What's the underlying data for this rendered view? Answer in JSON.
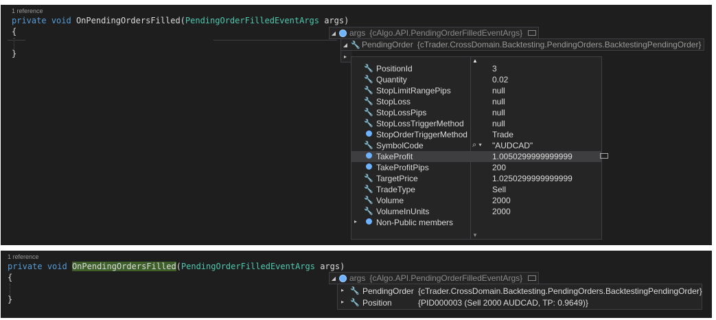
{
  "panel1": {
    "ref_label": "1 reference",
    "code": {
      "kw1": "private",
      "kw2": "void",
      "method": "OnPendingOrdersFilled",
      "paren_open": "(",
      "param_type": "PendingOrderFilledEventArgs",
      "param_name": " args)",
      "brace_open": "{",
      "brace_close": "}"
    },
    "tip_args": {
      "name": "args",
      "value": "{cAlgo.API.PendingOrderFilledEventArgs}"
    },
    "tip_pending": {
      "name": "PendingOrder",
      "value": "{cTrader.CrossDomain.Backtesting.PendingOrders.BacktestingPendingOrder}"
    },
    "properties": [
      {
        "name": "PositionId",
        "value": "3",
        "icon": "wrench-icon"
      },
      {
        "name": "Quantity",
        "value": "0.02",
        "icon": "wrench-icon"
      },
      {
        "name": "StopLimitRangePips",
        "value": "null",
        "icon": "wrench-icon"
      },
      {
        "name": "StopLoss",
        "value": "null",
        "icon": "wrench-icon"
      },
      {
        "name": "StopLossPips",
        "value": "null",
        "icon": "wrench-icon"
      },
      {
        "name": "StopLossTriggerMethod",
        "value": "null",
        "icon": "wrench-icon"
      },
      {
        "name": "StopOrderTriggerMethod",
        "value": "Trade",
        "icon": "property-icon"
      },
      {
        "name": "SymbolCode",
        "value": "\"AUDCAD\"",
        "icon": "wrench-icon"
      },
      {
        "name": "TakeProfit",
        "value": "1.0050299999999999",
        "icon": "property-icon"
      },
      {
        "name": "TakeProfitPips",
        "value": "200",
        "icon": "property-icon"
      },
      {
        "name": "TargetPrice",
        "value": "1.0250299999999999",
        "icon": "wrench-icon"
      },
      {
        "name": "TradeType",
        "value": "Sell",
        "icon": "wrench-icon"
      },
      {
        "name": "Volume",
        "value": "2000",
        "icon": "wrench-icon"
      },
      {
        "name": "VolumeInUnits",
        "value": "2000",
        "icon": "wrench-icon"
      }
    ],
    "non_public": "Non-Public members"
  },
  "panel2": {
    "ref_label": "1 reference",
    "code": {
      "kw1": "private",
      "kw2": "void",
      "method": "OnPendingOrdersFilled",
      "paren_open": "(",
      "param_type": "PendingOrderFilledEventArgs",
      "param_name": " args)",
      "brace_open": "{",
      "brace_close": "}"
    },
    "tip_args": {
      "name": "args",
      "value": "{cAlgo.API.PendingOrderFilledEventArgs}"
    },
    "rows": [
      {
        "name": "PendingOrder",
        "value": "{cTrader.CrossDomain.Backtesting.PendingOrders.BacktestingPendingOrder}"
      },
      {
        "name": "Position",
        "value": "{PID000003 (Sell 2000 AUDCAD, TP: 0.9649)}"
      }
    ]
  },
  "colors": {
    "background": "#1e1e1e",
    "keyword": "#569cd6",
    "type": "#4ec9b0",
    "highlight": "#3f5f2a"
  }
}
